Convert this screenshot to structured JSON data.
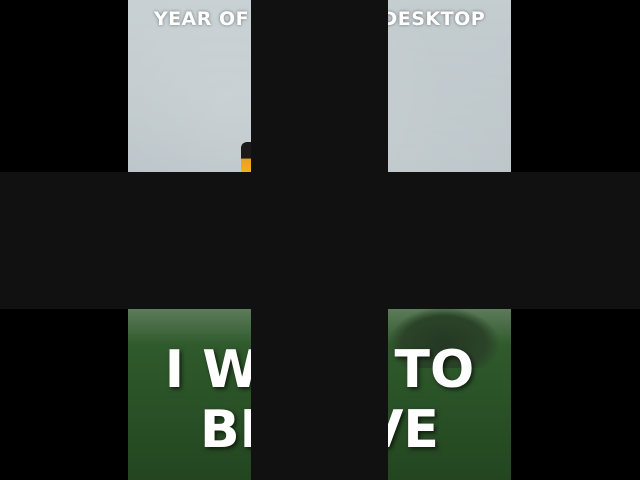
{
  "poster": {
    "top_caption": "YEAR OF THE LINUX DESKTOP",
    "bottom_caption_line1": "I WANT TO",
    "bottom_caption_line2": "BELIEVE"
  },
  "colors": {
    "background": "#000000",
    "redaction": "#111111",
    "caption_text": "#ffffff",
    "sky": "#b8c2c6",
    "grass": "#2f5a2c"
  }
}
